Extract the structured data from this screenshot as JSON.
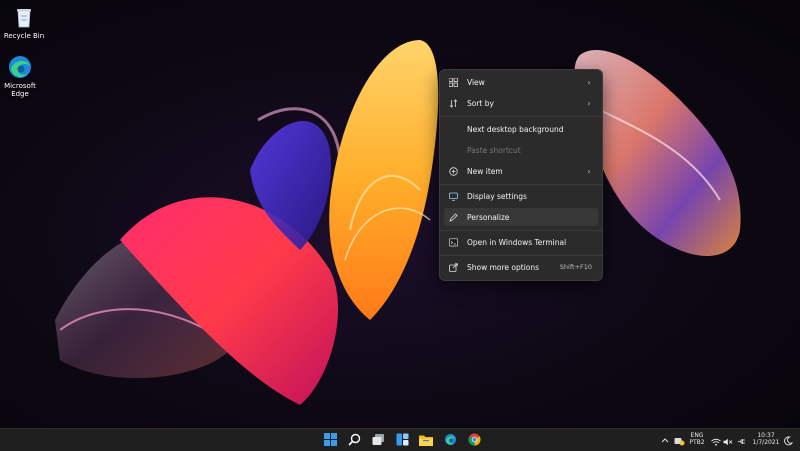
{
  "desktop": {
    "icons": [
      {
        "label": "Recycle Bin",
        "icon": "recycle-bin-icon"
      },
      {
        "label_line1": "Microsoft",
        "label_line2": "Edge",
        "icon": "edge-icon"
      }
    ]
  },
  "context_menu": {
    "items": [
      {
        "label": "View",
        "icon": "grid-icon",
        "submenu": true
      },
      {
        "label": "Sort by",
        "icon": "sort-icon",
        "submenu": true
      },
      {
        "label": "Next desktop background",
        "icon": "",
        "submenu": false
      },
      {
        "label": "Paste shortcut",
        "icon": "",
        "submenu": false,
        "disabled": true
      },
      {
        "label": "New item",
        "icon": "plus-circle-icon",
        "submenu": true
      },
      {
        "label": "Display settings",
        "icon": "display-icon",
        "submenu": false
      },
      {
        "label": "Personalize",
        "icon": "pen-icon",
        "submenu": false,
        "highlighted": true
      },
      {
        "label": "Open in Windows Terminal",
        "icon": "terminal-icon",
        "submenu": false
      },
      {
        "label": "Show more options",
        "icon": "share-icon",
        "submenu": false,
        "shortcut": "Shift+F10"
      }
    ],
    "submenu_arrow": "›"
  },
  "taskbar": {
    "apps": [
      "start-icon",
      "search-icon",
      "task-view-icon",
      "widgets-icon",
      "file-explorer-icon",
      "edge-icon",
      "chrome-icon"
    ],
    "tray": {
      "language": "ENG",
      "keyboard": "PTB2",
      "time": "10:37",
      "date": "1/7/2021"
    }
  },
  "colors": {
    "menu_bg": "#2b2b2b",
    "menu_hover": "#383838",
    "taskbar_bg": "#1f1f1f",
    "accent_blue": "#3a8ee6"
  }
}
